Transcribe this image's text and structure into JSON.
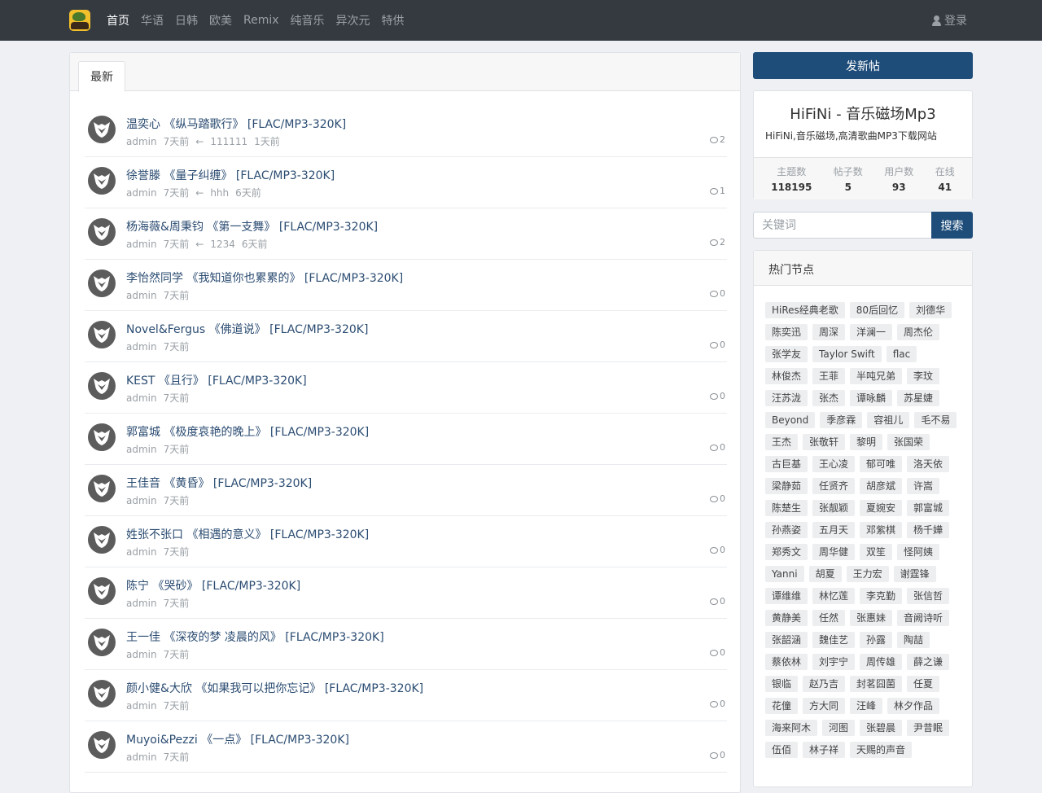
{
  "nav": {
    "links": [
      "首页",
      "华语",
      "日韩",
      "欧美",
      "Remix",
      "纯音乐",
      "异次元",
      "特供"
    ],
    "active": 0,
    "login": "登录"
  },
  "main": {
    "tab": "最新",
    "threads": [
      {
        "title": "温奕心 《纵马踏歌行》 [FLAC/MP3-320K]",
        "author": "admin",
        "time": "7天前",
        "arrow": "←",
        "last_user": "111111",
        "last_time": "1天前",
        "replies": "2"
      },
      {
        "title": "徐誉滕 《量子纠缠》 [FLAC/MP3-320K]",
        "author": "admin",
        "time": "7天前",
        "arrow": "←",
        "last_user": "hhh",
        "last_time": "6天前",
        "replies": "1"
      },
      {
        "title": "杨海薇&周秉钧 《第一支舞》 [FLAC/MP3-320K]",
        "author": "admin",
        "time": "7天前",
        "arrow": "←",
        "last_user": "1234",
        "last_time": "6天前",
        "replies": "2"
      },
      {
        "title": "李怡然同学 《我知道你也累累的》 [FLAC/MP3-320K]",
        "author": "admin",
        "time": "7天前",
        "replies": "0"
      },
      {
        "title": "Novel&Fergus 《佛道说》 [FLAC/MP3-320K]",
        "author": "admin",
        "time": "7天前",
        "replies": "0"
      },
      {
        "title": "KEST 《且行》 [FLAC/MP3-320K]",
        "author": "admin",
        "time": "7天前",
        "replies": "0"
      },
      {
        "title": "郭富城 《极度哀艳的晚上》 [FLAC/MP3-320K]",
        "author": "admin",
        "time": "7天前",
        "replies": "0"
      },
      {
        "title": "王佳音 《黄昏》 [FLAC/MP3-320K]",
        "author": "admin",
        "time": "7天前",
        "replies": "0"
      },
      {
        "title": "姓张不张口 《相遇的意义》 [FLAC/MP3-320K]",
        "author": "admin",
        "time": "7天前",
        "replies": "0"
      },
      {
        "title": "陈宁 《哭砂》 [FLAC/MP3-320K]",
        "author": "admin",
        "time": "7天前",
        "replies": "0"
      },
      {
        "title": "王一佳 《深夜的梦 凌晨的风》 [FLAC/MP3-320K]",
        "author": "admin",
        "time": "7天前",
        "replies": "0"
      },
      {
        "title": "颜小健&大欣 《如果我可以把你忘记》 [FLAC/MP3-320K]",
        "author": "admin",
        "time": "7天前",
        "replies": "0"
      },
      {
        "title": "Muyoi&Pezzi 《一点》 [FLAC/MP3-320K]",
        "author": "admin",
        "time": "7天前",
        "replies": "0"
      }
    ]
  },
  "sidebar": {
    "post_button": "发新帖",
    "site_title": "HiFiNi - 音乐磁场Mp3",
    "site_desc": "HiFiNi,音乐磁场,高清歌曲MP3下载网站",
    "stats": [
      {
        "label": "主题数",
        "value": "118195"
      },
      {
        "label": "帖子数",
        "value": "5"
      },
      {
        "label": "用户数",
        "value": "93"
      },
      {
        "label": "在线",
        "value": "41"
      }
    ],
    "search_placeholder": "关键词",
    "search_button": "搜索",
    "hot_title": "热门节点",
    "tags": [
      "HiRes经典老歌",
      "80后回忆",
      "刘德华",
      "陈奕迅",
      "周深",
      "洋澜一",
      "周杰伦",
      "张学友",
      "Taylor Swift",
      "flac",
      "林俊杰",
      "王菲",
      "半吨兄弟",
      "李玟",
      "汪苏泷",
      "张杰",
      "谭咏麟",
      "苏星婕",
      "Beyond",
      "季彦霖",
      "容祖儿",
      "毛不易",
      "王杰",
      "张敬轩",
      "黎明",
      "张国荣",
      "古巨基",
      "王心凌",
      "郁可唯",
      "洛天依",
      "梁静茹",
      "任贤齐",
      "胡彦斌",
      "许嵩",
      "陈楚生",
      "张靓颖",
      "夏婉安",
      "郭富城",
      "孙燕姿",
      "五月天",
      "邓紫棋",
      "杨千嬅",
      "郑秀文",
      "周华健",
      "双笙",
      "怪阿姨",
      "Yanni",
      "胡夏",
      "王力宏",
      "谢霆锋",
      "谭维维",
      "林忆莲",
      "李克勤",
      "张信哲",
      "黄静美",
      "任然",
      "张惠妹",
      "音阙诗听",
      "张韶涵",
      "魏佳艺",
      "孙露",
      "陶喆",
      "蔡依林",
      "刘宇宁",
      "周传雄",
      "薛之谦",
      "银临",
      "赵乃吉",
      "封茗囧菌",
      "任夏",
      "花僮",
      "方大同",
      "汪峰",
      "林夕作品",
      "海来阿木",
      "河图",
      "张碧晨",
      "尹昔眠",
      "伍佰",
      "林子祥",
      "天赐的声音"
    ]
  }
}
